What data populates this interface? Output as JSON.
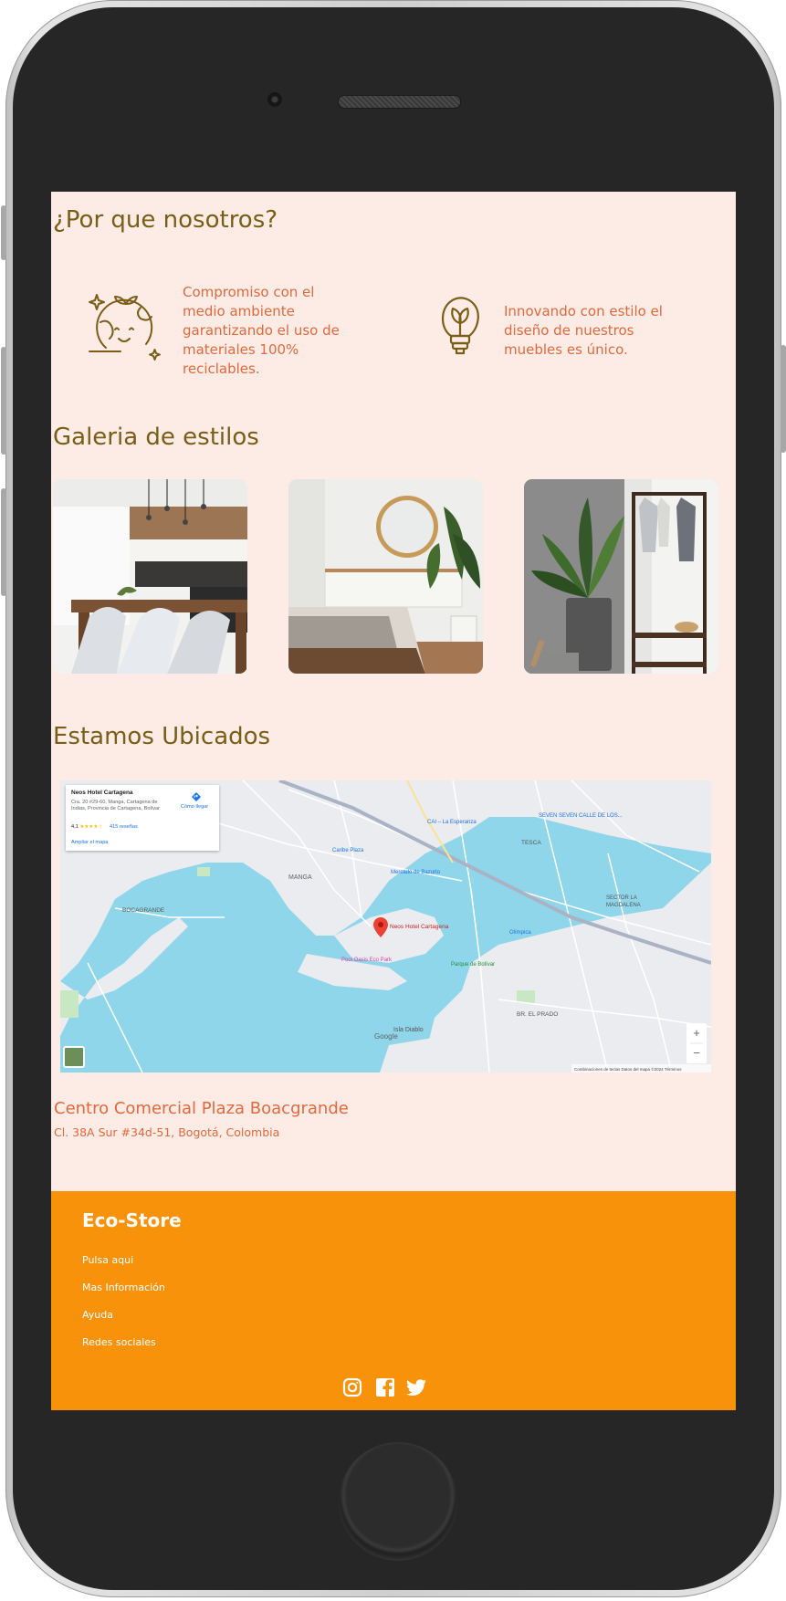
{
  "why": {
    "title": "¿Por que nosotros?",
    "features": [
      {
        "icon": "smiling-earth-icon",
        "text": "Compromiso con el medio ambiente garantizando el uso de materiales 100% reciclables."
      },
      {
        "icon": "lightbulb-leaf-icon",
        "text": "Innovando con estilo el diseño de nuestros muebles es único."
      }
    ]
  },
  "gallery": {
    "title": "Galeria de estilos",
    "images": [
      "kitchen-dining-photo",
      "bedroom-photo",
      "plant-clothes-rack-photo"
    ]
  },
  "location": {
    "title": "Estamos Ubicados",
    "map": {
      "card_title": "Neos Hotel Cartagena",
      "card_address": "Cra. 20 #29-60, Manga, Cartagena de Indias, Provincia de Cartagena, Bolívar",
      "rating": "4,1",
      "stars": "★★★★☆",
      "reviews": "415 reseñas",
      "directions": "Cómo llegar",
      "enlarge": "Ampliar el mapa",
      "pin_label": "Neos Hotel Cartagena",
      "zoom_in": "+",
      "zoom_out": "−",
      "google": "Google",
      "attribution": "Combinaciones de teclas   Datos del mapa ©2024   Términos",
      "labels": {
        "manga": "MANGA",
        "bocagrande": "BOCAGRANDE",
        "tesca": "TESCA",
        "sector": "SECTOR LA MAGDALENA",
        "prado": "BR. EL PRADO",
        "isla": "Isla Diablo",
        "caribe": "Caribe Plaza",
        "mercado": "Mercado de Bazurto",
        "ecopark": "Pool Oasis Eco Park",
        "olimpica": "Olímpica",
        "parque": "Parque de Bolívar",
        "seven": "SEVEN SEVEN CALLE DE LOS...",
        "cai": "CAI – La Esperanza"
      }
    },
    "place_name": "Centro Comercial Plaza Boacgrande",
    "place_address": "Cl. 38A Sur #34d-51, Bogotá, Colombia"
  },
  "footer": {
    "brand": "Eco-Store",
    "links": [
      "Pulsa aqui",
      "Mas Información",
      "Ayuda",
      "Redes sociales"
    ],
    "social": [
      "instagram-icon",
      "facebook-icon",
      "twitter-icon"
    ]
  },
  "colors": {
    "background": "#fdece5",
    "heading": "#7a5e17",
    "accent": "#e0693d",
    "footer": "#f7920a",
    "phone_body": "#262626"
  }
}
